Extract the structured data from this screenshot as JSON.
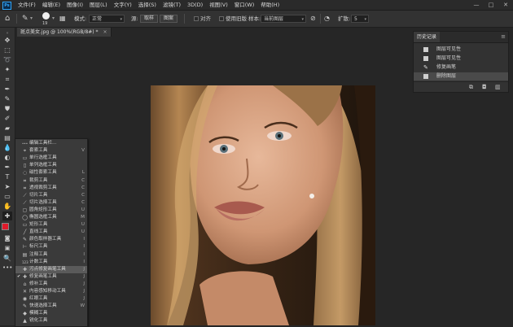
{
  "menubar": {
    "logo": "Ps",
    "items": [
      "文件(F)",
      "编辑(E)",
      "图像(I)",
      "图层(L)",
      "文字(Y)",
      "选择(S)",
      "滤镜(T)",
      "3D(D)",
      "视图(V)",
      "窗口(W)",
      "帮助(H)"
    ],
    "window_buttons": [
      "—",
      "□",
      "✕"
    ]
  },
  "optbar": {
    "brush_size": "19",
    "mode_label": "模式:",
    "mode_value": "正常",
    "source_label": "源:",
    "source_sample": "取样",
    "source_pattern": "图案",
    "align_label": "对齐",
    "legacy_label": "使用旧版",
    "sample_label": "样本:",
    "sample_value": "当前图层",
    "diffusion_label": "扩散:",
    "diffusion_value": "5"
  },
  "document": {
    "tab_label": "斑点美女.jpg @ 100%(RGB/8#) *",
    "close": "×"
  },
  "history": {
    "tab": "历史记录",
    "menu": "≡",
    "rows": [
      {
        "label": "图层可见性",
        "selected": false
      },
      {
        "label": "图层可见性",
        "selected": false
      },
      {
        "label": "修复画笔",
        "selected": false
      },
      {
        "label": "删除图层",
        "selected": true
      }
    ],
    "footer_icons": [
      "snapshot-icon",
      "camera-icon",
      "trash-icon"
    ]
  },
  "flyout": {
    "items": [
      {
        "label": "编辑工具栏...",
        "key": "",
        "icon": "•••",
        "checked": false
      },
      {
        "label": "套索工具",
        "key": "V",
        "icon": "⌖",
        "checked": false
      },
      {
        "label": "单行选框工具",
        "key": "",
        "icon": "▭",
        "checked": false
      },
      {
        "label": "单列选框工具",
        "key": "",
        "icon": "▯",
        "checked": false
      },
      {
        "label": "磁性套索工具",
        "key": "L",
        "icon": "◌",
        "checked": false
      },
      {
        "label": "裁剪工具",
        "key": "C",
        "icon": "⌗",
        "checked": false
      },
      {
        "label": "透视裁剪工具",
        "key": "C",
        "icon": "⌗",
        "checked": false
      },
      {
        "label": "切片工具",
        "key": "C",
        "icon": "⟋",
        "checked": false
      },
      {
        "label": "切片选择工具",
        "key": "C",
        "icon": "⟋",
        "checked": false
      },
      {
        "label": "圆角矩形工具",
        "key": "U",
        "icon": "▢",
        "checked": false
      },
      {
        "label": "椭圆选框工具",
        "key": "M",
        "icon": "◯",
        "checked": false
      },
      {
        "label": "矩形工具",
        "key": "U",
        "icon": "▭",
        "checked": false
      },
      {
        "label": "直线工具",
        "key": "U",
        "icon": "╱",
        "checked": false
      },
      {
        "label": "颜色取样器工具",
        "key": "I",
        "icon": "✎",
        "checked": false
      },
      {
        "label": "标尺工具",
        "key": "I",
        "icon": "⊢",
        "checked": false
      },
      {
        "label": "注释工具",
        "key": "I",
        "icon": "▤",
        "checked": false
      },
      {
        "label": "计数工具",
        "key": "I",
        "icon": "123",
        "checked": false
      },
      {
        "label": "污点修复画笔工具",
        "key": "J",
        "icon": "✚",
        "checked": false
      },
      {
        "label": "修复画笔工具",
        "key": "J",
        "icon": "✚",
        "checked": true
      },
      {
        "label": "修补工具",
        "key": "J",
        "icon": "⌂",
        "checked": false
      },
      {
        "label": "内容感知移动工具",
        "key": "J",
        "icon": "✕",
        "checked": false
      },
      {
        "label": "红眼工具",
        "key": "J",
        "icon": "◉",
        "checked": false
      },
      {
        "label": "快速选择工具",
        "key": "W",
        "icon": "✎",
        "checked": false
      },
      {
        "label": "模糊工具",
        "key": "",
        "icon": "◆",
        "checked": false
      },
      {
        "label": "锐化工具",
        "key": "",
        "icon": "▲",
        "checked": false
      }
    ],
    "highlighted_index": 17
  },
  "toolbar": {
    "tools": [
      "move-icon",
      "marquee-icon",
      "lasso-icon",
      "magic-wand-icon",
      "crop-icon",
      "eyedropper-icon",
      "healing-brush-icon",
      "brush-icon",
      "clone-stamp-icon",
      "history-brush-icon",
      "eraser-icon",
      "gradient-icon",
      "blur-icon",
      "dodge-icon",
      "pen-icon",
      "type-icon",
      "path-select-icon",
      "shape-icon",
      "hand-icon",
      "zoom-icon",
      "more-icon"
    ],
    "foreground_color": "#e01a2b",
    "background_color": "#ffffff"
  }
}
